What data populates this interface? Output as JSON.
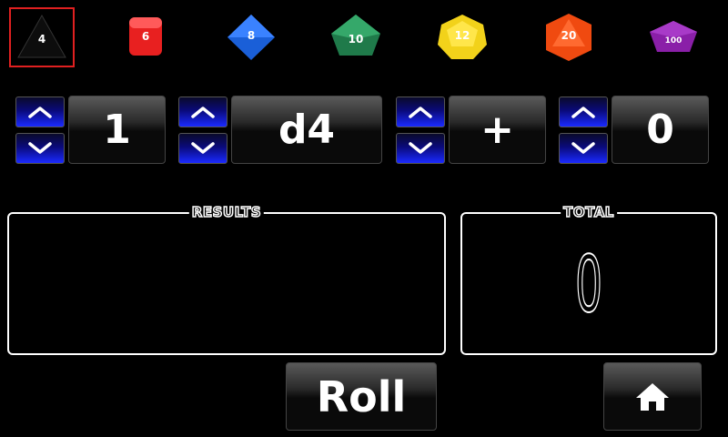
{
  "dice": [
    {
      "label": "4",
      "color": "#111111",
      "selected": true
    },
    {
      "label": "6",
      "color": "#e82020"
    },
    {
      "label": "8",
      "color": "#1a5fd8"
    },
    {
      "label": "10",
      "color": "#1f7a4a"
    },
    {
      "label": "12",
      "color": "#f2d21a"
    },
    {
      "label": "20",
      "color": "#f04a10"
    },
    {
      "label": "100",
      "color": "#8a1fa8"
    }
  ],
  "controls": {
    "count": "1",
    "die_type": "d4",
    "operator": "+",
    "modifier": "0"
  },
  "results": {
    "label": "RESULTS",
    "content": ""
  },
  "total": {
    "label": "TOTAL",
    "value": "0"
  },
  "roll_label": "Roll",
  "colors": {
    "accent_blue": "#1a2aff",
    "selected_outline": "#e02020"
  }
}
